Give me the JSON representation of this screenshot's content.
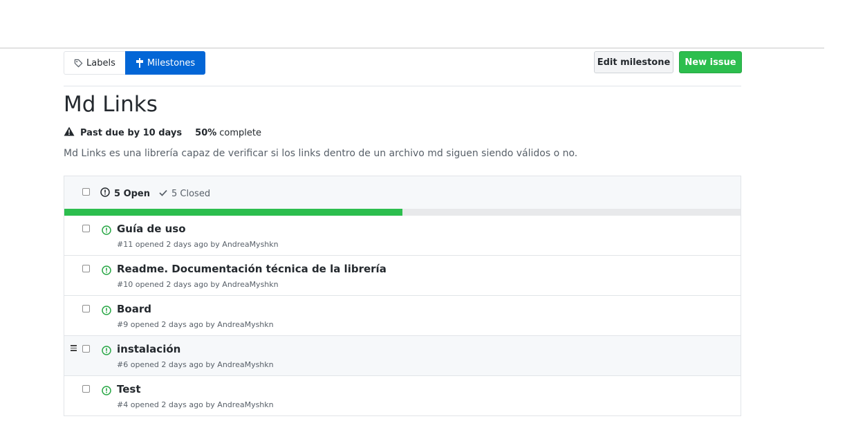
{
  "subnav": {
    "labels_label": "Labels",
    "milestones_label": "Milestones"
  },
  "actions": {
    "edit_label": "Edit milestone",
    "new_issue_label": "New issue"
  },
  "milestone": {
    "title": "Md Links",
    "due_status": "Past due by 10 days",
    "percent": "50%",
    "complete_label": "complete",
    "progress_fraction": 0.5,
    "description": "Md Links es una librería capaz de verificar si los links dentro de un archivo md siguen siendo válidos o no."
  },
  "filters": {
    "open_label": "5 Open",
    "closed_label": "5 Closed"
  },
  "issues": [
    {
      "title": "Guía de uso",
      "meta": "#11 opened 2 days ago by AndreaMyshkn"
    },
    {
      "title": "Readme. Documentación técnica de la librería",
      "meta": "#10 opened 2 days ago by AndreaMyshkn"
    },
    {
      "title": "Board",
      "meta": "#9 opened 2 days ago by AndreaMyshkn"
    },
    {
      "title": "instalación",
      "meta": "#6 opened 2 days ago by AndreaMyshkn"
    },
    {
      "title": "Test",
      "meta": "#4 opened 2 days ago by AndreaMyshkn"
    }
  ],
  "colors": {
    "accent": "#0366d6",
    "success": "#2cbe4e",
    "open_issue": "#28a745"
  }
}
